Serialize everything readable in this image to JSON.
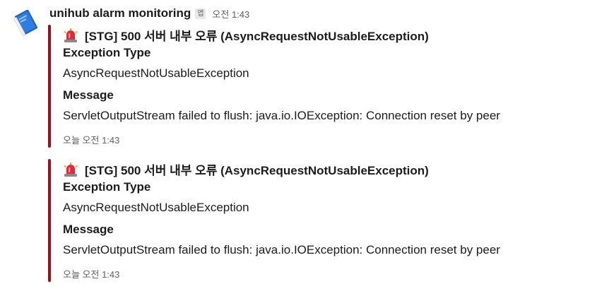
{
  "message": {
    "sender": "unihub alarm monitoring",
    "app_badge": "앱",
    "time": "오전 1:43",
    "avatar_icon": "book-icon"
  },
  "accent_color": "#a30c1a",
  "attachments": [
    {
      "icon": "rotating-light-icon",
      "title": "[STG] 500 서버 내부 오류 (AsyncRequestNotUsableException)",
      "fields": [
        {
          "label": "Exception Type",
          "value": "AsyncRequestNotUsableException"
        },
        {
          "label": "Message",
          "value": "ServletOutputStream failed to flush: java.io.IOException: Connection reset by peer"
        }
      ],
      "footer": "오늘 오전 1:43"
    },
    {
      "icon": "rotating-light-icon",
      "title": "[STG] 500 서버 내부 오류 (AsyncRequestNotUsableException)",
      "fields": [
        {
          "label": "Exception Type",
          "value": "AsyncRequestNotUsableException"
        },
        {
          "label": "Message",
          "value": "ServletOutputStream failed to flush: java.io.IOException: Connection reset by peer"
        }
      ],
      "footer": "오늘 오전 1:43"
    }
  ]
}
